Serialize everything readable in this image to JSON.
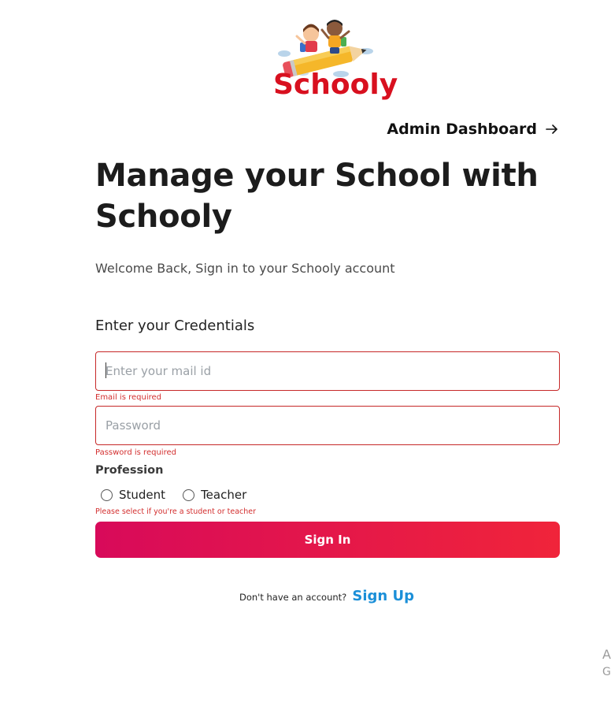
{
  "logo": {
    "text": "Schooly",
    "brand_color": "#d8101f"
  },
  "header": {
    "admin_link_label": "Admin Dashboard",
    "admin_link_icon": "arrow-right-icon"
  },
  "hero": {
    "headline": "Manage your School with Schooly",
    "subtitle": "Welcome Back, Sign in to your Schooly account"
  },
  "form": {
    "credentials_title": "Enter your Credentials",
    "email": {
      "placeholder": "Enter your mail id",
      "value": "",
      "error": "Email is required"
    },
    "password": {
      "placeholder": "Password",
      "value": "",
      "error": "Password is required"
    },
    "profession": {
      "label": "Profession",
      "options": [
        "Student",
        "Teacher"
      ],
      "selected": null,
      "error": "Please select if you're a student or teacher"
    },
    "submit_label": "Sign In",
    "submit_gradient": [
      "#d80a5a",
      "#f0243a"
    ],
    "error_color": "#d32f2f"
  },
  "footer": {
    "signup_prompt": "Don't have an account?",
    "signup_link": "Sign Up",
    "link_color": "#1b8fd8"
  },
  "corner": {
    "line1": "A",
    "line2": "G"
  }
}
